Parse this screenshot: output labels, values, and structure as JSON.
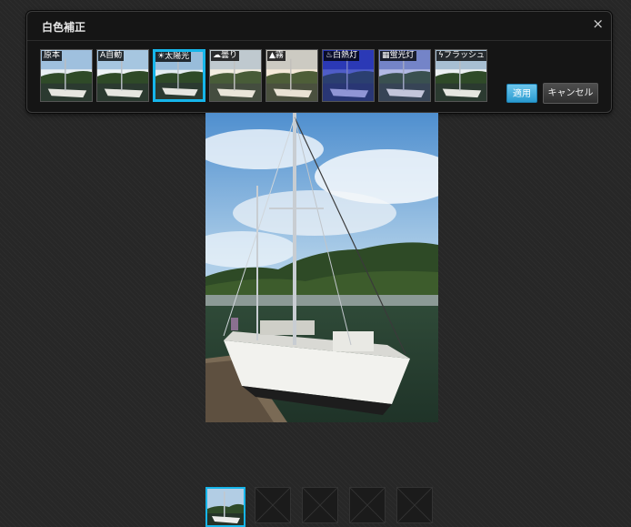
{
  "dialog": {
    "title": "白色補正",
    "close_glyph": "×",
    "presets": [
      {
        "label": "原本",
        "icon": "",
        "tint": "none",
        "selected": false
      },
      {
        "label": "自動",
        "icon": "A",
        "tint": "auto",
        "selected": false
      },
      {
        "label": "太陽光",
        "icon": "☀",
        "tint": "daylight",
        "selected": true
      },
      {
        "label": "曇り",
        "icon": "☁",
        "tint": "cloudy",
        "selected": false
      },
      {
        "label": "霧",
        "icon": "▲",
        "tint": "shade",
        "selected": false
      },
      {
        "label": "白熱灯",
        "icon": "♨",
        "tint": "tungsten",
        "selected": false
      },
      {
        "label": "蛍光灯",
        "icon": "▦",
        "tint": "fluorescent",
        "selected": false
      },
      {
        "label": "フラッシュ",
        "icon": "ϟ",
        "tint": "flash",
        "selected": false
      }
    ],
    "apply_label": "適用",
    "cancel_label": "キャンセル"
  },
  "filmstrip": {
    "items": [
      {
        "kind": "photo",
        "active": true
      },
      {
        "kind": "empty",
        "active": false
      },
      {
        "kind": "empty",
        "active": false
      },
      {
        "kind": "empty",
        "active": false
      },
      {
        "kind": "empty",
        "active": false
      }
    ]
  },
  "colors": {
    "accent": "#16b5ea",
    "apply_button": "#4ab3e2",
    "panel_bg": "#151515",
    "page_bg": "#272727"
  }
}
